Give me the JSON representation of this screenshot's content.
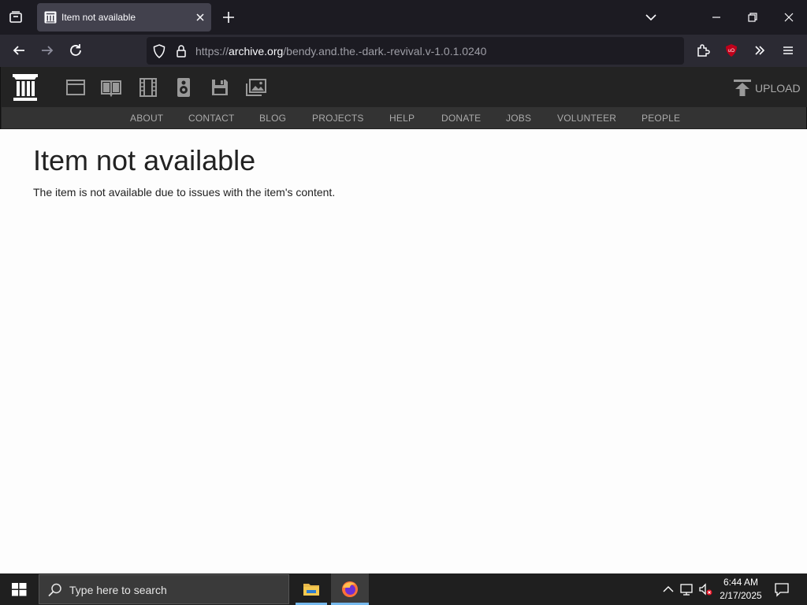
{
  "browser": {
    "tab_title": "Item not available",
    "url_prefix": "https://",
    "url_host": "archive.org",
    "url_path": "/bendy.and.the.-dark.-revival.v-1.0.1.0240"
  },
  "ia": {
    "media_icons": [
      "web-icon",
      "texts-icon",
      "video-icon",
      "audio-icon",
      "software-icon",
      "images-icon"
    ],
    "upload_label": "UPLOAD",
    "nav": [
      "ABOUT",
      "CONTACT",
      "BLOG",
      "PROJECTS",
      "HELP",
      "DONATE",
      "JOBS",
      "VOLUNTEER",
      "PEOPLE"
    ]
  },
  "page": {
    "title": "Item not available",
    "message": "The item is not available due to issues with the item's content."
  },
  "taskbar": {
    "search_placeholder": "Type here to search",
    "time": "6:44 AM",
    "date": "2/17/2025"
  },
  "colors": {
    "browser_dark": "#1c1b22",
    "toolbar": "#2b2a33",
    "ia_header": "#232323",
    "ia_nav": "#333333",
    "taskbar": "#1f1f1f"
  }
}
